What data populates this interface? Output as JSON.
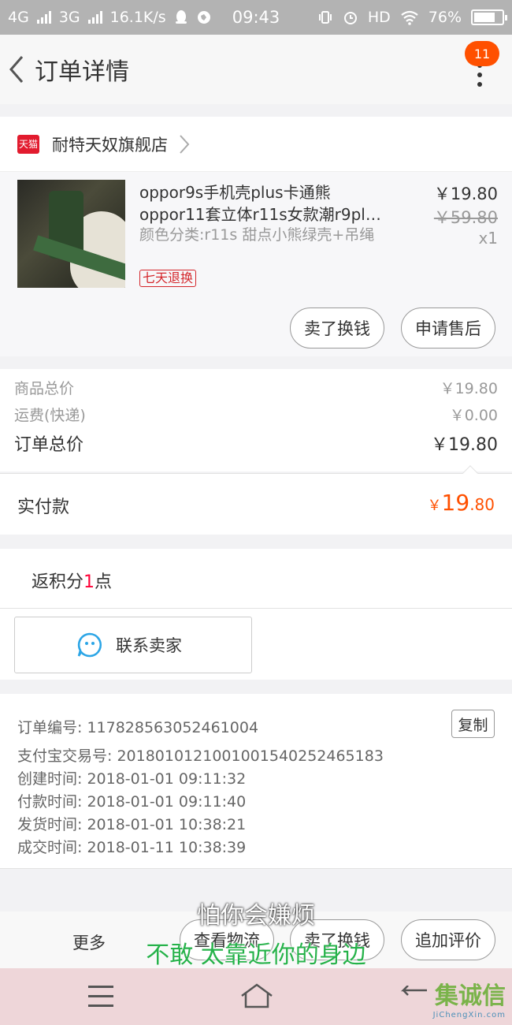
{
  "status_bar": {
    "network1": "4G",
    "network2": "3G",
    "speed": "16.1K/s",
    "time": "09:43",
    "hd": "HD",
    "battery": "76%"
  },
  "navbar": {
    "title": "订单详情",
    "badge": "11"
  },
  "shop": {
    "logo_text": "天猫",
    "name": "耐特天奴旗舰店"
  },
  "product": {
    "title_line1": "oppor9s手机壳plus卡通熊",
    "title_line2": "oppor11套立体r11s女款潮r9pl…",
    "sku": "颜色分类:r11s 甜点小熊绿壳+吊绳",
    "tag": "七天退换",
    "price": "￥19.80",
    "original_price": "￥59.80",
    "quantity": "x1",
    "btn_sell": "卖了换钱",
    "btn_after_sale": "申请售后"
  },
  "totals": {
    "goods_label": "商品总价",
    "goods_value": "￥19.80",
    "shipping_label": "运费(快递)",
    "shipping_value": "￥0.00",
    "order_label": "订单总价",
    "order_value": "￥19.80"
  },
  "paid": {
    "label": "实付款",
    "currency": "￥",
    "integer": "19",
    "decimal": ".80"
  },
  "points": {
    "prefix": "返积分",
    "count": "1",
    "suffix": "点"
  },
  "contact": {
    "label": "联系卖家"
  },
  "order_info": {
    "order_no": "订单编号: 117828563052461004",
    "alipay_no": "支付宝交易号: 2018010121001001540252465183",
    "created": "创建时间: 2018-01-01 09:11:32",
    "paid": "付款时间: 2018-01-01 09:11:40",
    "shipped": "发货时间: 2018-01-01 10:38:21",
    "completed": "成交时间: 2018-01-11 10:38:39",
    "copy_label": "复制"
  },
  "footer": {
    "more": "更多",
    "logistics": "查看物流",
    "sell": "卖了换钱",
    "review": "追加评价"
  },
  "subtitles": {
    "line1": "怕你会嫌烦",
    "line2": "不敢 太靠近你的身边"
  },
  "watermark": {
    "big": "集诚信",
    "small": "JiChengXin.com"
  }
}
